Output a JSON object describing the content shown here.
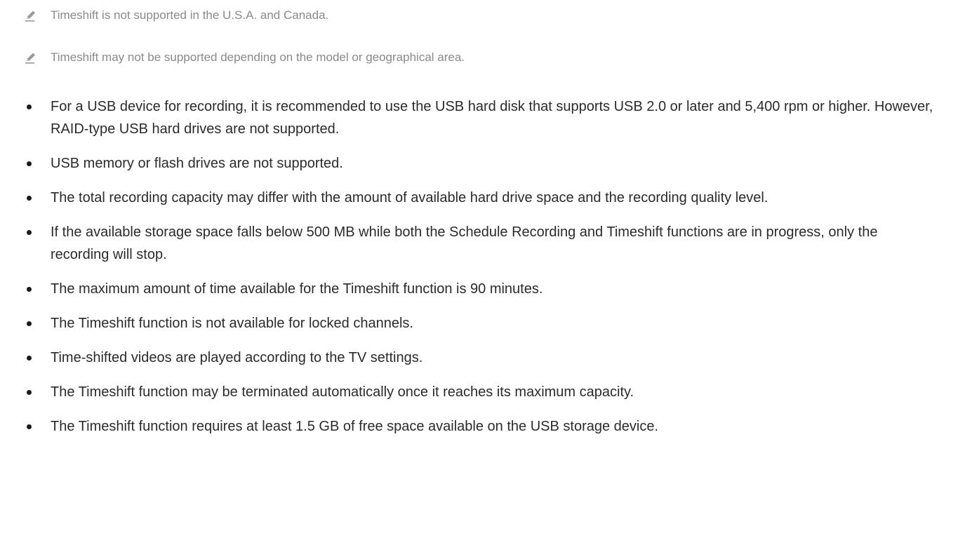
{
  "notes": [
    {
      "icon": "pencil-note-icon",
      "text": "Timeshift is not supported in the U.S.A. and Canada."
    },
    {
      "icon": "pencil-note-icon",
      "text": "Timeshift may not be supported depending on the model or geographical area."
    }
  ],
  "bullets": [
    "For a USB device for recording, it is recommended to use the USB hard disk that supports USB 2.0 or later and 5,400 rpm or higher. However, RAID-type USB hard drives are not supported.",
    "USB memory or flash drives are not supported.",
    "The total recording capacity may differ with the amount of available hard drive space and the recording quality level.",
    "If the available storage space falls below 500 MB while both the Schedule Recording and Timeshift functions are in progress, only the recording will stop.",
    "The maximum amount of time available for the Timeshift function is 90 minutes.",
    "The Timeshift function is not available for locked channels.",
    "Time-shifted videos are played according to the TV settings.",
    "The Timeshift function may be terminated automatically once it reaches its maximum capacity.",
    "The Timeshift function requires at least 1.5 GB of free space available on the USB storage device."
  ],
  "colors": {
    "note_text": "#8a8a8a",
    "body_text": "#2b2b2b",
    "icon": "#9a9a9a"
  }
}
